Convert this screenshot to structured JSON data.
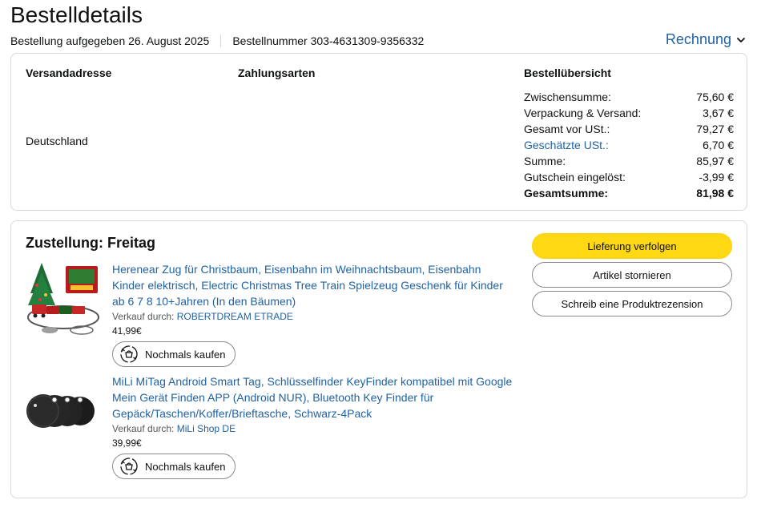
{
  "page": {
    "title": "Bestelldetails",
    "order_placed": "Bestellung aufgegeben 26. August 2025",
    "order_number": "Bestellnummer 303-4631309-9356332",
    "invoice_label": "Rechnung"
  },
  "summary": {
    "shipping_address_heading": "Versandadresse",
    "payment_heading": "Zahlungsarten",
    "overview_heading": "Bestellübersicht",
    "country": "Deutschland",
    "rows": [
      {
        "label": "Zwischensumme:",
        "value": "75,60 €"
      },
      {
        "label": "Verpackung & Versand:",
        "value": "3,67 €"
      },
      {
        "label": "Gesamt vor USt.:",
        "value": "79,27 €"
      },
      {
        "label": "Geschätzte USt.:",
        "value": "6,70 €"
      },
      {
        "label": "Summe:",
        "value": "85,97 €"
      },
      {
        "label": "Gutschein eingelöst:",
        "value": "-3,99 €"
      },
      {
        "label": "Gesamtsumme:",
        "value": "81,98 €"
      }
    ]
  },
  "delivery": {
    "title": "Zustellung: Freitag",
    "track_label": "Lieferung verfolgen",
    "cancel_label": "Artikel stornieren",
    "review_label": "Schreib eine Produktrezension",
    "items": [
      {
        "title": "Herenear Zug für Christbaum, Eisenbahn im Weihnachtsbaum, Eisenbahn Kinder elektrisch, Electric Christmas Tree Train Spielzeug Geschenk für Kinder ab 6 7 8 10+Jahren (In den Bäumen)",
        "seller_prefix": "Verkauf durch:",
        "seller": "ROBERTDREAM ETRADE",
        "price": "41,99€",
        "rebuy_label": "Nochmals kaufen"
      },
      {
        "title": "MiLi MiTag Android Smart Tag, Schlüsselfinder KeyFinder kompatibel mit Google Mein Gerät Finden APP (Android NUR), Bluetooth Key Finder für Gepäck/Taschen/Koffer/Brieftasche, Schwarz-4Pack",
        "seller_prefix": "Verkauf durch:",
        "seller": "MiLi Shop DE",
        "price": "39,99€",
        "rebuy_label": "Nochmals kaufen"
      }
    ]
  },
  "colors": {
    "link": "#2162a1",
    "primary_button": "#ffd814",
    "border": "#d5d9d9"
  },
  "icons": {
    "invoice": "chevron-down-icon",
    "rebuy": "rebuy-cycle-icon",
    "train_thumbnail": "product-image-train",
    "tag_thumbnail": "product-image-smart-tag"
  }
}
